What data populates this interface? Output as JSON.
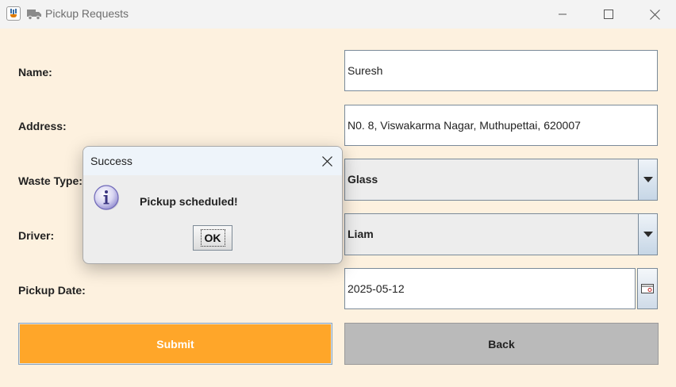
{
  "window": {
    "title": "Pickup Requests"
  },
  "form": {
    "name": {
      "label": "Name:",
      "value": "Suresh"
    },
    "address": {
      "label": "Address:",
      "value": "N0. 8, Viswakarma Nagar, Muthupettai, 620007"
    },
    "waste_type": {
      "label": "Waste Type:",
      "value": "Glass"
    },
    "driver": {
      "label": "Driver:",
      "value": "Liam"
    },
    "pickup_date": {
      "label": "Pickup Date:",
      "value": "2025-05-12"
    },
    "submit_label": "Submit",
    "back_label": "Back"
  },
  "dialog": {
    "title": "Success",
    "message": "Pickup scheduled!",
    "ok_label": "OK",
    "icon": "info-icon"
  },
  "colors": {
    "background": "#fdf1df",
    "submit": "#ffa629",
    "back": "#bababa"
  }
}
